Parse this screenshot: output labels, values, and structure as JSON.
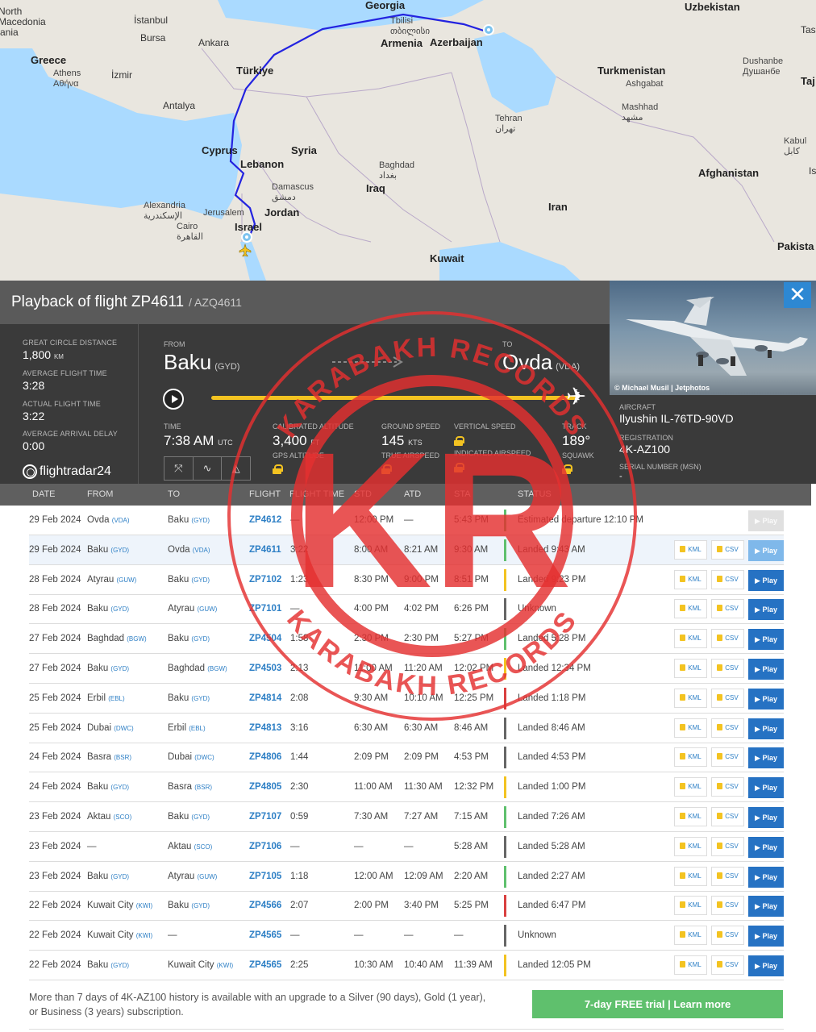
{
  "map": {
    "labels": {
      "north_macedonia": "North\nMacedonia",
      "istanbul": "İstanbul",
      "georgia": "Georgia",
      "tbilisi": "Tbilisi",
      "tbilisi_alt": "თბილისი",
      "uzbekistan": "Uzbekistan",
      "bursa": "Bursa",
      "ankara": "Ankara",
      "armenia": "Armenia",
      "azerbaijan": "Azerbaijan",
      "greece": "Greece",
      "athens": "Athens",
      "athens_alt": "Αθήνα",
      "izmir": "İzmir",
      "turkiye": "Türkiye",
      "turkmenistan": "Turkmenistan",
      "ashgabat": "Ashgabat",
      "dushanbe": "Dushanbe",
      "dushanbe_alt": "Душанбе",
      "antalya": "Antalya",
      "mashhad": "Mashhad",
      "mashhad_alt": "مشهد",
      "tehran": "Tehran",
      "tehran_alt": "تهران",
      "cyprus": "Cyprus",
      "syria": "Syria",
      "lebanon": "Lebanon",
      "baghdad": "Baghdad",
      "baghdad_alt": "بغداد",
      "kabul": "Kabul",
      "kabul_alt": "کابل",
      "damascus": "Damascus",
      "damascus_alt": "دمشق",
      "iraq": "Iraq",
      "afghanistan": "Afghanistan",
      "alexandria": "Alexandria",
      "alexandria_alt": "الإسكندرية",
      "jerusalem": "Jerusalem",
      "jordan": "Jordan",
      "israel": "Israel",
      "iran": "Iran",
      "cairo": "Cairo",
      "cairo_alt": "القاهرة",
      "kuwait": "Kuwait",
      "pakistan": "Pakista",
      "ania": "ania",
      "tas": "Tas",
      "taj": "Taj",
      "is": "Is"
    },
    "route_color": "#2323e0"
  },
  "panel": {
    "title": "Playback of flight ZP4611",
    "callsign": "/ AZQ4611",
    "close_icon": "close-icon",
    "photo_credit": "© Michael Musil | Jetphotos"
  },
  "stats": {
    "gcd_label": "Great circle distance",
    "gcd_value": "1,800",
    "gcd_unit": "KM",
    "aft_label": "Average flight time",
    "aft_value": "3:28",
    "act_label": "Actual flight time",
    "act_value": "3:22",
    "delay_label": "Average arrival delay",
    "delay_value": "0:00",
    "logo": "flightradar24"
  },
  "route": {
    "from_label": "FROM",
    "from_city": "Baku",
    "from_iata": "(GYD)",
    "to_label": "TO",
    "to_city": "Ovda",
    "to_iata": "(VDA)",
    "progress": 1.0
  },
  "live": {
    "time_label": "TIME",
    "time_value": "7:38 AM",
    "time_unit": "UTC",
    "alt_label": "CALIBRATED ALTITUDE",
    "alt_value": "3,400",
    "alt_unit": "FT",
    "gps_label": "GPS ALTITUDE",
    "gs_label": "GROUND SPEED",
    "gs_value": "145",
    "gs_unit": "KTS",
    "tas_label": "TRUE AIRSPEED",
    "vs_label": "VERTICAL SPEED",
    "ias_label": "INDICATED AIRSPEED",
    "track_label": "TRACK",
    "track_value": "189°",
    "squawk_label": "SQUAWK"
  },
  "aircraft": {
    "aircraft_label": "AIRCRAFT",
    "aircraft_value": "Ilyushin IL-76TD-90VD",
    "reg_label": "REGISTRATION",
    "reg_value": "4K-AZ100",
    "msn_label": "SERIAL NUMBER (MSN)",
    "msn_value": "-"
  },
  "table": {
    "headers": [
      "DATE",
      "FROM",
      "TO",
      "FLIGHT",
      "FLIGHT TIME",
      "STD",
      "ATD",
      "STA",
      "STATUS"
    ],
    "kml_label": "KML",
    "csv_label": "CSV",
    "play_label": "▶ Play",
    "rows": [
      {
        "date": "29 Feb 2024",
        "from": "Ovda",
        "from_iata": "(VDA)",
        "to": "Baku",
        "to_iata": "(GYD)",
        "flight": "ZP4612",
        "ftime": "—",
        "std": "12:00 PM",
        "atd": "—",
        "sta": "5:43 PM",
        "status": "Estimated departure 12:10 PM",
        "bar": "#5fc06d",
        "variant": "disabled"
      },
      {
        "date": "29 Feb 2024",
        "from": "Baku",
        "from_iata": "(GYD)",
        "to": "Ovda",
        "to_iata": "(VDA)",
        "flight": "ZP4611",
        "ftime": "3:22",
        "std": "8:00 AM",
        "atd": "8:21 AM",
        "sta": "9:30 AM",
        "status": "Landed 9:43 AM",
        "bar": "#5fc06d",
        "variant": "light"
      },
      {
        "date": "28 Feb 2024",
        "from": "Atyrau",
        "from_iata": "(GUW)",
        "to": "Baku",
        "to_iata": "(GYD)",
        "flight": "ZP7102",
        "ftime": "1:23",
        "std": "8:30 PM",
        "atd": "9:00 PM",
        "sta": "8:51 PM",
        "status": "Landed 9:23 PM",
        "bar": "#f3c321",
        "variant": "normal"
      },
      {
        "date": "28 Feb 2024",
        "from": "Baku",
        "from_iata": "(GYD)",
        "to": "Atyrau",
        "to_iata": "(GUW)",
        "flight": "ZP7101",
        "ftime": "—",
        "std": "4:00 PM",
        "atd": "4:02 PM",
        "sta": "6:26 PM",
        "status": "Unknown",
        "bar": "#666666",
        "variant": "normal"
      },
      {
        "date": "27 Feb 2024",
        "from": "Baghdad",
        "from_iata": "(BGW)",
        "to": "Baku",
        "to_iata": "(GYD)",
        "flight": "ZP4504",
        "ftime": "1:58",
        "std": "2:30 PM",
        "atd": "2:30 PM",
        "sta": "5:27 PM",
        "status": "Landed 5:28 PM",
        "bar": "#5fc06d",
        "variant": "normal"
      },
      {
        "date": "27 Feb 2024",
        "from": "Baku",
        "from_iata": "(GYD)",
        "to": "Baghdad",
        "to_iata": "(BGW)",
        "flight": "ZP4503",
        "ftime": "2:13",
        "std": "11:00 AM",
        "atd": "11:20 AM",
        "sta": "12:02 PM",
        "status": "Landed 12:34 PM",
        "bar": "#f3c321",
        "variant": "normal"
      },
      {
        "date": "25 Feb 2024",
        "from": "Erbil",
        "from_iata": "(EBL)",
        "to": "Baku",
        "to_iata": "(GYD)",
        "flight": "ZP4814",
        "ftime": "2:08",
        "std": "9:30 AM",
        "atd": "10:10 AM",
        "sta": "12:25 PM",
        "status": "Landed 1:18 PM",
        "bar": "#d94040",
        "variant": "normal"
      },
      {
        "date": "25 Feb 2024",
        "from": "Dubai",
        "from_iata": "(DWC)",
        "to": "Erbil",
        "to_iata": "(EBL)",
        "flight": "ZP4813",
        "ftime": "3:16",
        "std": "6:30 AM",
        "atd": "6:30 AM",
        "sta": "8:46 AM",
        "status": "Landed 8:46 AM",
        "bar": "#666666",
        "variant": "normal"
      },
      {
        "date": "24 Feb 2024",
        "from": "Basra",
        "from_iata": "(BSR)",
        "to": "Dubai",
        "to_iata": "(DWC)",
        "flight": "ZP4806",
        "ftime": "1:44",
        "std": "2:09 PM",
        "atd": "2:09 PM",
        "sta": "4:53 PM",
        "status": "Landed 4:53 PM",
        "bar": "#666666",
        "variant": "normal"
      },
      {
        "date": "24 Feb 2024",
        "from": "Baku",
        "from_iata": "(GYD)",
        "to": "Basra",
        "to_iata": "(BSR)",
        "flight": "ZP4805",
        "ftime": "2:30",
        "std": "11:00 AM",
        "atd": "11:30 AM",
        "sta": "12:32 PM",
        "status": "Landed 1:00 PM",
        "bar": "#f3c321",
        "variant": "normal"
      },
      {
        "date": "23 Feb 2024",
        "from": "Aktau",
        "from_iata": "(SCO)",
        "to": "Baku",
        "to_iata": "(GYD)",
        "flight": "ZP7107",
        "ftime": "0:59",
        "std": "7:30 AM",
        "atd": "7:27 AM",
        "sta": "7:15 AM",
        "status": "Landed 7:26 AM",
        "bar": "#5fc06d",
        "variant": "normal"
      },
      {
        "date": "23 Feb 2024",
        "from": "—",
        "from_iata": "",
        "to": "Aktau",
        "to_iata": "(SCO)",
        "flight": "ZP7106",
        "ftime": "—",
        "std": "—",
        "atd": "—",
        "sta": "5:28 AM",
        "status": "Landed 5:28 AM",
        "bar": "#666666",
        "variant": "normal"
      },
      {
        "date": "23 Feb 2024",
        "from": "Baku",
        "from_iata": "(GYD)",
        "to": "Atyrau",
        "to_iata": "(GUW)",
        "flight": "ZP7105",
        "ftime": "1:18",
        "std": "12:00 AM",
        "atd": "12:09 AM",
        "sta": "2:20 AM",
        "status": "Landed 2:27 AM",
        "bar": "#5fc06d",
        "variant": "normal"
      },
      {
        "date": "22 Feb 2024",
        "from": "Kuwait City",
        "from_iata": "(KWI)",
        "to": "Baku",
        "to_iata": "(GYD)",
        "flight": "ZP4566",
        "ftime": "2:07",
        "std": "2:00 PM",
        "atd": "3:40 PM",
        "sta": "5:25 PM",
        "status": "Landed 6:47 PM",
        "bar": "#d94040",
        "variant": "normal"
      },
      {
        "date": "22 Feb 2024",
        "from": "Kuwait City",
        "from_iata": "(KWI)",
        "to": "—",
        "to_iata": "",
        "flight": "ZP4565",
        "ftime": "—",
        "std": "—",
        "atd": "—",
        "sta": "—",
        "status": "Unknown",
        "bar": "#666666",
        "variant": "normal"
      },
      {
        "date": "22 Feb 2024",
        "from": "Baku",
        "from_iata": "(GYD)",
        "to": "Kuwait City",
        "to_iata": "(KWI)",
        "flight": "ZP4565",
        "ftime": "2:25",
        "std": "10:30 AM",
        "atd": "10:40 AM",
        "sta": "11:39 AM",
        "status": "Landed 12:05 PM",
        "bar": "#f3c321",
        "variant": "normal"
      }
    ]
  },
  "footer": {
    "text": "More than 7 days of 4K-AZ100 history is available with an upgrade to a Silver (90 days), Gold (1 year), or Business (3 years) subscription.",
    "trial_button": "7-day FREE trial | Learn more"
  },
  "watermark": {
    "text": "KARABAKH RECORDS",
    "monogram": "KR",
    "color": "#e53030"
  }
}
